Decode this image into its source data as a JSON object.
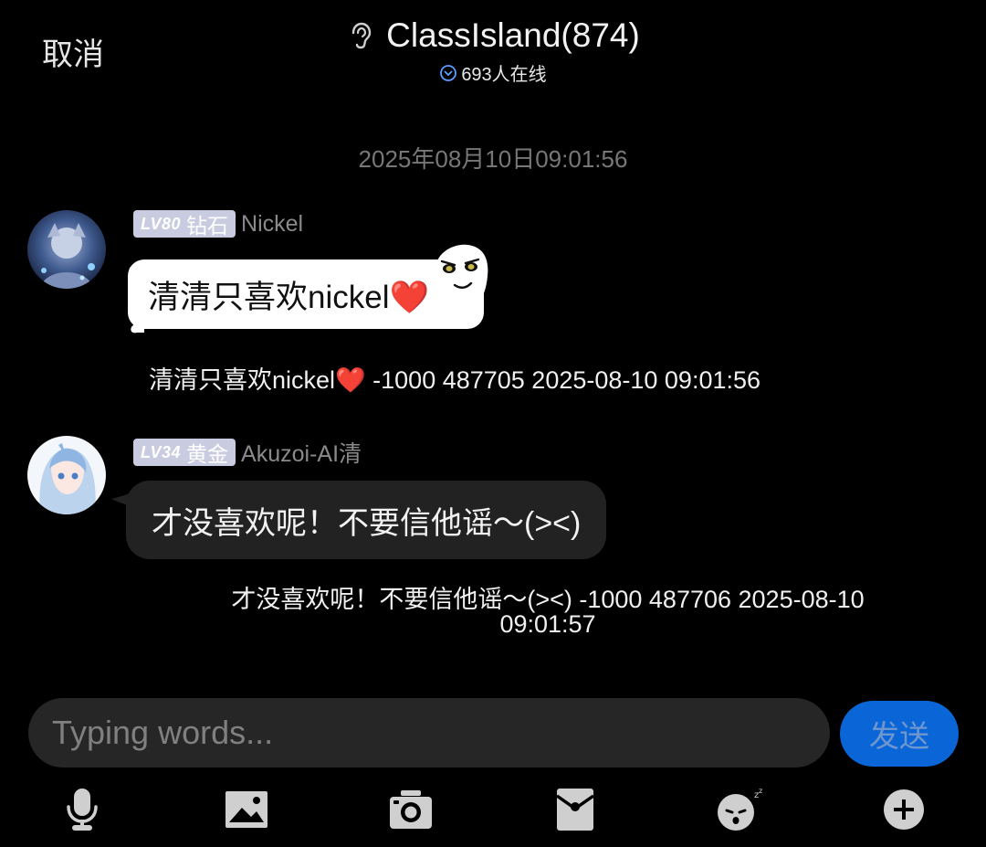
{
  "header": {
    "cancel_label": "取消",
    "title": "ClassIsland(874)",
    "online": "693人在线"
  },
  "timestamp": "2025年08月10日09:01:56",
  "messages": [
    {
      "badge_lv": "LV80",
      "badge_rank": "钻石",
      "sender": "Nickel",
      "text": "清清只喜欢nickel❤️",
      "log": "清清只喜欢nickel❤️ -1000 487705   2025-08-10 09:01:56"
    },
    {
      "badge_lv": "LV34",
      "badge_rank": "黄金",
      "sender": "Akuzoi-AI清",
      "text": "才没喜欢呢！不要信他谣～(><)",
      "log_line1": "才没喜欢呢！不要信他谣～(><) -1000 487706   2025-08-10",
      "log_line2": "09:01:57"
    }
  ],
  "input": {
    "placeholder": "Typing words...",
    "value": ""
  },
  "send_label": "发送",
  "toolbar": [
    "microphone-icon",
    "image-icon",
    "camera-icon",
    "red-packet-icon",
    "sticker-icon",
    "plus-icon"
  ],
  "colors": {
    "background": "#000000",
    "send_button": "#0a65d6",
    "badge": "#c9cbe0",
    "other_bubble": "#222222"
  }
}
